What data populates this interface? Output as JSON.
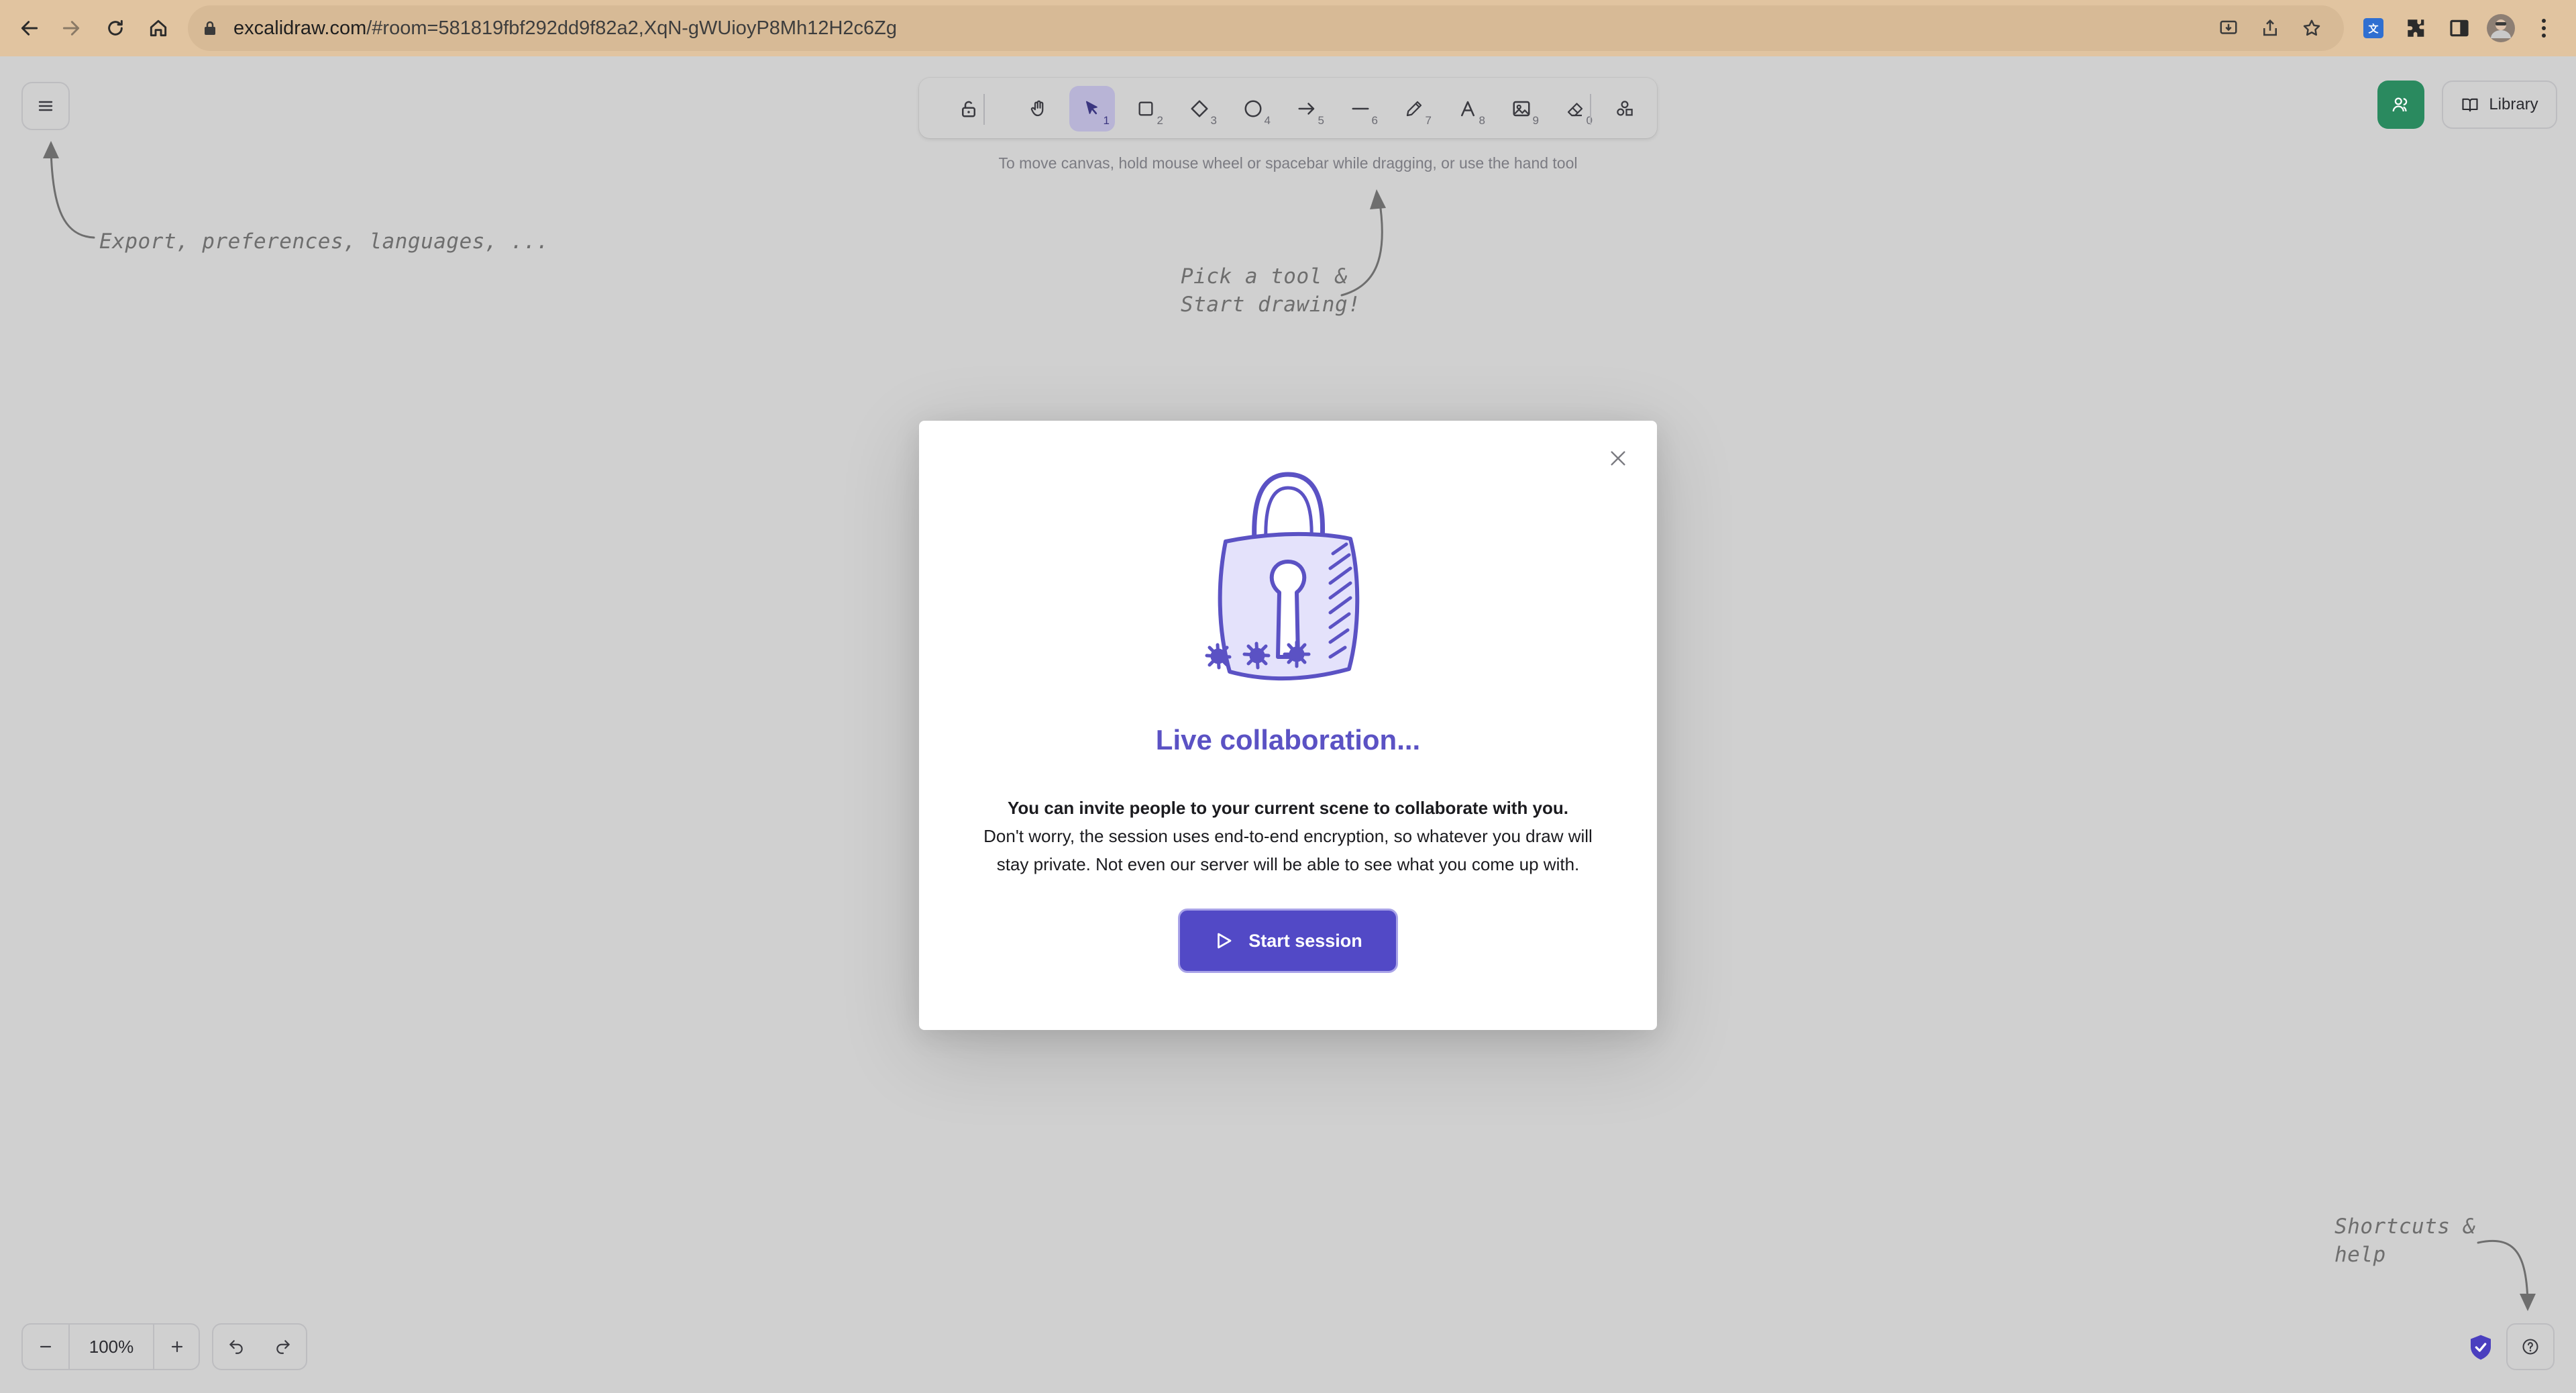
{
  "browser": {
    "url_host": "excalidraw.com",
    "url_rest": "/#room=581819fbf292dd9f82a2,XqN-gWUioyP8Mh12H2c6Zg"
  },
  "toolbar": {
    "keys": [
      "1",
      "2",
      "3",
      "4",
      "5",
      "6",
      "7",
      "8",
      "9",
      "0"
    ]
  },
  "canvas": {
    "hint": "To move canvas, hold mouse wheel or spacebar while dragging, or use the hand tool",
    "note_menu": "Export, preferences, languages, ...",
    "note_tool_line1": "Pick a tool &",
    "note_tool_line2": "Start drawing!",
    "note_help_line1": "Shortcuts &",
    "note_help_line2": "help"
  },
  "top_right": {
    "library_label": "Library"
  },
  "footer": {
    "zoom_value": "100%"
  },
  "modal": {
    "title": "Live collaboration...",
    "lead": "You can invite people to your current scene to collaborate with you.",
    "body_line1": "Don't worry, the session uses end-to-end encryption, so whatever you draw will",
    "body_line2": "stay private. Not even our server will be able to see what you come up with.",
    "start_label": "Start session"
  },
  "colors": {
    "accent": "#5b52c4",
    "button": "#5249c6",
    "collab_green": "#2a8a5f",
    "chrome": "#e1c4a0"
  }
}
